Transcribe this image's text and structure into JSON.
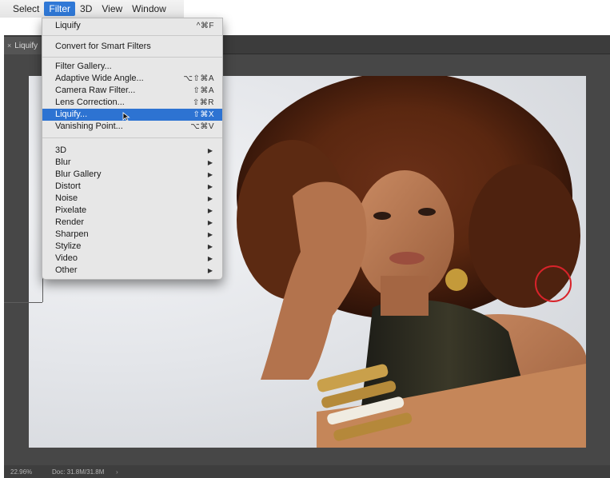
{
  "menubar": {
    "items": [
      "Select",
      "Filter",
      "3D",
      "View",
      "Window"
    ]
  },
  "document": {
    "tab_title": "Liquify",
    "close_glyph": "×",
    "status": {
      "zoom": "22.96%",
      "doc_size": "Doc: 31.8M/31.8M",
      "arrow": "›"
    }
  },
  "filter_menu": {
    "last_filter": {
      "label": "Liquify",
      "shortcut": "^⌘F"
    },
    "convert_smart": "Convert for Smart Filters",
    "filters": [
      {
        "label": "Filter Gallery...",
        "shortcut": ""
      },
      {
        "label": "Adaptive Wide Angle...",
        "shortcut": "⌥⇧⌘A"
      },
      {
        "label": "Camera Raw Filter...",
        "shortcut": "⇧⌘A"
      },
      {
        "label": "Lens Correction...",
        "shortcut": "⇧⌘R"
      },
      {
        "label": "Liquify...",
        "shortcut": "⇧⌘X"
      },
      {
        "label": "Vanishing Point...",
        "shortcut": "⌥⌘V"
      }
    ],
    "highlighted": "Liquify...",
    "submenu_arrow": "▶",
    "submenus": [
      "3D",
      "Blur",
      "Blur Gallery",
      "Distort",
      "Noise",
      "Pixelate",
      "Render",
      "Sharpen",
      "Stylize",
      "Video",
      "Other"
    ]
  },
  "colors": {
    "menu_highlight": "#2d73d2",
    "annotation_circle": "#d8232a",
    "workspace_gray": "#474747"
  }
}
